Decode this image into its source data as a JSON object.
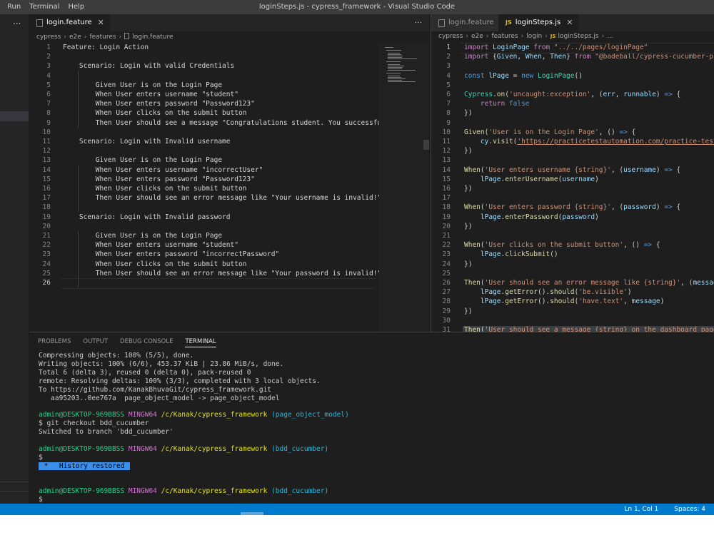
{
  "menu": [
    "Run",
    "Terminal",
    "Help"
  ],
  "window_title": "loginSteps.js - cypress_framework - Visual Studio Code",
  "sidebar_more": "···",
  "left_editor": {
    "tab": "login.feature",
    "more": "···",
    "breadcrumb": [
      "cypress",
      "e2e",
      "features",
      "login.feature"
    ],
    "lines": [
      "Feature: Login Action",
      "",
      "    Scenario: Login with valid Credentials",
      "",
      "        Given User is on the Login Page",
      "        When User enters username \"student\"",
      "        When User enters password \"Password123\"",
      "        When User clicks on the submit button",
      "        Then User should see a message \"Congratulations student. You successfully l",
      "",
      "    Scenario: Login with Invalid username",
      "",
      "        Given User is on the Login Page",
      "        When User enters username \"incorrectUser\"",
      "        When User enters password \"Password123\"",
      "        When User clicks on the submit button",
      "        Then User should see an error message like \"Your username is invalid!\"",
      "",
      "    Scenario: Login with Invalid password",
      "",
      "        Given User is on the Login Page",
      "        When User enters username \"student\"",
      "        When User enters password \"incorrectPassword\"",
      "        When User clicks on the submit button",
      "        Then User should see an error message like \"Your password is invalid!\"",
      ""
    ]
  },
  "right_editor": {
    "tabs": [
      {
        "label": "login.feature",
        "active": false
      },
      {
        "label": "loginSteps.js",
        "active": true,
        "icon": "JS",
        "close": "✕"
      }
    ],
    "breadcrumb": [
      "cypress",
      "e2e",
      "features",
      "login",
      "loginSteps.js",
      "..."
    ],
    "lines": [
      [
        [
          "kw",
          "import "
        ],
        [
          "vr",
          "LoginPage"
        ],
        [
          "kw",
          " from "
        ],
        [
          "st",
          "\"../../pages/loginPage\""
        ]
      ],
      [
        [
          "kw",
          "import "
        ],
        [
          "pu",
          "{"
        ],
        [
          "vr",
          "Given"
        ],
        [
          "pu",
          ", "
        ],
        [
          "vr",
          "When"
        ],
        [
          "pu",
          ", "
        ],
        [
          "vr",
          "Then"
        ],
        [
          "pu",
          "} "
        ],
        [
          "kw",
          "from "
        ],
        [
          "st",
          "\"@badeball/cypress-cucumber-prepr"
        ]
      ],
      [],
      [
        [
          "bl",
          "const "
        ],
        [
          "vr",
          "lPage"
        ],
        [
          "pu",
          " = "
        ],
        [
          "bl",
          "new "
        ],
        [
          "cl",
          "LoginPage"
        ],
        [
          "pu",
          "()"
        ]
      ],
      [],
      [
        [
          "cl",
          "Cypress"
        ],
        [
          "pu",
          "."
        ],
        [
          "fn",
          "on"
        ],
        [
          "pu",
          "("
        ],
        [
          "st",
          "'uncaught:exception'"
        ],
        [
          "pu",
          ", ("
        ],
        [
          "vr",
          "err"
        ],
        [
          "pu",
          ", "
        ],
        [
          "vr",
          "runnable"
        ],
        [
          "pu",
          ") "
        ],
        [
          "bl",
          "=>"
        ],
        [
          "pu",
          " {"
        ]
      ],
      [
        [
          "kw",
          "    return "
        ],
        [
          "bl",
          "false"
        ]
      ],
      [
        [
          "pu",
          "})"
        ]
      ],
      [],
      [
        [
          "fn",
          "Given"
        ],
        [
          "pu",
          "("
        ],
        [
          "st",
          "'User is on the Login Page'"
        ],
        [
          "pu",
          ", () "
        ],
        [
          "bl",
          "=>"
        ],
        [
          "pu",
          " {"
        ]
      ],
      [
        [
          "vr",
          "    cy"
        ],
        [
          "pu",
          "."
        ],
        [
          "fn",
          "visit"
        ],
        [
          "pu",
          "("
        ],
        [
          "lk",
          "'https://practicetestautomation.com/practice-test-lo"
        ]
      ],
      [
        [
          "pu",
          "})"
        ]
      ],
      [],
      [
        [
          "fn",
          "When"
        ],
        [
          "pu",
          "("
        ],
        [
          "st",
          "'User enters username {string}'"
        ],
        [
          "pu",
          ", ("
        ],
        [
          "vr",
          "username"
        ],
        [
          "pu",
          ") "
        ],
        [
          "bl",
          "=>"
        ],
        [
          "pu",
          " {"
        ]
      ],
      [
        [
          "vr",
          "    lPage"
        ],
        [
          "pu",
          "."
        ],
        [
          "fn",
          "enterUsername"
        ],
        [
          "pu",
          "("
        ],
        [
          "vr",
          "username"
        ],
        [
          "pu",
          ")"
        ]
      ],
      [
        [
          "pu",
          "})"
        ]
      ],
      [],
      [
        [
          "fn",
          "When"
        ],
        [
          "pu",
          "("
        ],
        [
          "st",
          "'User enters password {string}'"
        ],
        [
          "pu",
          ", ("
        ],
        [
          "vr",
          "password"
        ],
        [
          "pu",
          ") "
        ],
        [
          "bl",
          "=>"
        ],
        [
          "pu",
          " {"
        ]
      ],
      [
        [
          "vr",
          "    lPage"
        ],
        [
          "pu",
          "."
        ],
        [
          "fn",
          "enterPassword"
        ],
        [
          "pu",
          "("
        ],
        [
          "vr",
          "password"
        ],
        [
          "pu",
          ")"
        ]
      ],
      [
        [
          "pu",
          "})"
        ]
      ],
      [],
      [
        [
          "fn",
          "When"
        ],
        [
          "pu",
          "("
        ],
        [
          "st",
          "'User clicks on the submit button'"
        ],
        [
          "pu",
          ", () "
        ],
        [
          "bl",
          "=>"
        ],
        [
          "pu",
          " {"
        ]
      ],
      [
        [
          "vr",
          "    lPage"
        ],
        [
          "pu",
          "."
        ],
        [
          "fn",
          "clickSubmit"
        ],
        [
          "pu",
          "()"
        ]
      ],
      [
        [
          "pu",
          "})"
        ]
      ],
      [],
      [
        [
          "fn",
          "Then"
        ],
        [
          "pu",
          "("
        ],
        [
          "st",
          "'User should see an error message like {string}'"
        ],
        [
          "pu",
          ", ("
        ],
        [
          "vr",
          "message"
        ],
        [
          "pu",
          ")"
        ]
      ],
      [
        [
          "vr",
          "    lPage"
        ],
        [
          "pu",
          "."
        ],
        [
          "fn",
          "getError"
        ],
        [
          "pu",
          "()."
        ],
        [
          "fn",
          "should"
        ],
        [
          "pu",
          "("
        ],
        [
          "st",
          "'be.visible'"
        ],
        [
          "pu",
          ")"
        ]
      ],
      [
        [
          "vr",
          "    lPage"
        ],
        [
          "pu",
          "."
        ],
        [
          "fn",
          "getError"
        ],
        [
          "pu",
          "()."
        ],
        [
          "fn",
          "should"
        ],
        [
          "pu",
          "("
        ],
        [
          "st",
          "'have.text'"
        ],
        [
          "pu",
          ", "
        ],
        [
          "vr",
          "message"
        ],
        [
          "pu",
          ")"
        ]
      ],
      [
        [
          "pu",
          "})"
        ]
      ],
      [],
      [
        [
          "fn",
          "Then"
        ],
        [
          "pu",
          "("
        ],
        [
          "st",
          "'User should see a message {string} on the dashboard page'"
        ],
        [
          "pu",
          ","
        ]
      ]
    ]
  },
  "panel": {
    "tabs": [
      {
        "label": "PROBLEMS",
        "active": false
      },
      {
        "label": "OUTPUT",
        "active": false
      },
      {
        "label": "DEBUG CONSOLE",
        "active": false
      },
      {
        "label": "TERMINAL",
        "active": true
      }
    ],
    "terminal": [
      {
        "row": 0,
        "segs": [
          [
            "",
            "Compressing objects: 100% (5/5), done."
          ]
        ]
      },
      {
        "row": 1,
        "segs": [
          [
            "",
            "Writing objects: 100% (6/6), 453.37 KiB | 23.86 MiB/s, done."
          ]
        ]
      },
      {
        "row": 2,
        "segs": [
          [
            "",
            "Total 6 (delta 3), reused 0 (delta 0), pack-reused 0"
          ]
        ]
      },
      {
        "row": 3,
        "segs": [
          [
            "",
            "remote: Resolving deltas: 100% (3/3), completed with 3 local objects."
          ]
        ]
      },
      {
        "row": 4,
        "segs": [
          [
            "",
            "To https://github.com/KanakBhuvaGit/cypress_framework.git"
          ]
        ]
      },
      {
        "row": 5,
        "segs": [
          [
            "",
            "   aa95203..0ee767a  page_object_model -> page_object_model"
          ]
        ]
      },
      {
        "row": 7,
        "segs": [
          [
            "t-green",
            "admin@DESKTOP-969BBSS"
          ],
          [
            "",
            " "
          ],
          [
            "t-purple",
            "MINGW64"
          ],
          [
            "",
            " "
          ],
          [
            "t-yellow",
            "/c/Kanak/cypress_framework"
          ],
          [
            "",
            " "
          ],
          [
            "t-cyan",
            "(page_object_model)"
          ]
        ]
      },
      {
        "row": 8,
        "segs": [
          [
            "",
            "$ git checkout bdd_cucumber"
          ]
        ]
      },
      {
        "row": 9,
        "segs": [
          [
            "",
            "Switched to branch 'bdd_cucumber'"
          ]
        ]
      },
      {
        "row": 11,
        "segs": [
          [
            "t-green",
            "admin@DESKTOP-969BBSS"
          ],
          [
            "",
            " "
          ],
          [
            "t-purple",
            "MINGW64"
          ],
          [
            "",
            " "
          ],
          [
            "t-yellow",
            "/c/Kanak/cypress_framework"
          ],
          [
            "",
            " "
          ],
          [
            "t-cyan",
            "(bdd_cucumber)"
          ]
        ]
      },
      {
        "row": 12,
        "segs": [
          [
            "",
            "$"
          ]
        ]
      },
      {
        "row": 13,
        "segs": [
          [
            "t-badge",
            " * "
          ],
          [
            "t-badge",
            " History restored "
          ]
        ]
      },
      {
        "row": 16,
        "segs": [
          [
            "t-green",
            "admin@DESKTOP-969BBSS"
          ],
          [
            "",
            " "
          ],
          [
            "t-purple",
            "MINGW64"
          ],
          [
            "",
            " "
          ],
          [
            "t-yellow",
            "/c/Kanak/cypress_framework"
          ],
          [
            "",
            " "
          ],
          [
            "t-cyan",
            "(bdd_cucumber)"
          ]
        ]
      },
      {
        "row": 17,
        "segs": [
          [
            "",
            "$"
          ]
        ]
      }
    ]
  },
  "status": {
    "position": "Ln 1, Col 1",
    "spaces": "Spaces: 4"
  },
  "colors": {
    "statusbar": "#007acc",
    "editor_bg": "#1e1e1e"
  }
}
